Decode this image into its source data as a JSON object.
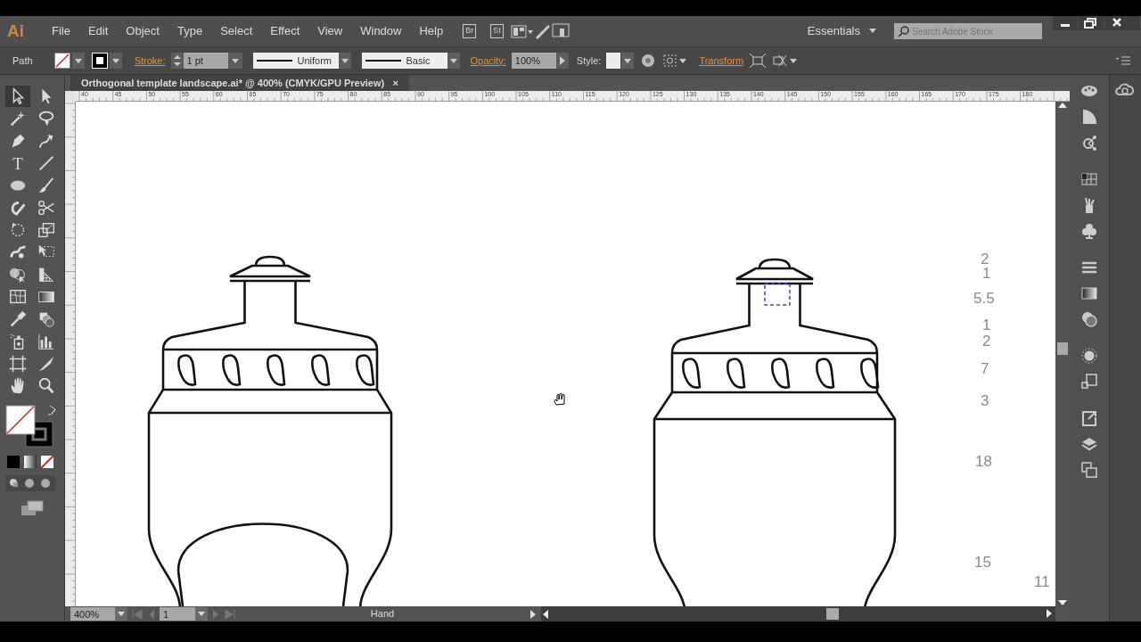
{
  "app": {
    "logo": "Ai"
  },
  "menu": [
    "File",
    "Edit",
    "Object",
    "Type",
    "Select",
    "Effect",
    "View",
    "Window",
    "Help"
  ],
  "app_bar": {
    "bridge": "Br",
    "stock": "St",
    "workspace": "Essentials",
    "search": {
      "placeholder": "Search Adobe Stock"
    }
  },
  "control_bar": {
    "selection": "Path",
    "stroke_label": "Stroke:",
    "stroke_weight": "1 pt",
    "profile": "Uniform",
    "brush": "Basic",
    "opacity_label": "Opacity:",
    "opacity": "100%",
    "style_label": "Style:",
    "transform": "Transform"
  },
  "document_tab": {
    "title": "Orthogonal template landscape.ai* @ 400% (CMYK/GPU Preview)",
    "close": "×"
  },
  "ruler": {
    "labels": [
      "40",
      "45",
      "50",
      "55",
      "60",
      "65",
      "70",
      "75",
      "80",
      "85",
      "90",
      "95",
      "100",
      "105",
      "110",
      "115",
      "120",
      "125",
      "130",
      "135",
      "140",
      "145",
      "150",
      "155",
      "160",
      "165",
      "170",
      "175",
      "180"
    ]
  },
  "tools": [
    {
      "kind": "selection",
      "selected": true
    },
    {
      "kind": "direct",
      "selected": false
    },
    {
      "kind": "wand",
      "selected": false
    },
    {
      "kind": "lasso",
      "selected": false
    },
    {
      "kind": "pen",
      "selected": false
    },
    {
      "kind": "curvature",
      "selected": false
    },
    {
      "kind": "type",
      "glyph": "T",
      "selected": false
    },
    {
      "kind": "line",
      "selected": false
    },
    {
      "kind": "ellipse",
      "selected": false
    },
    {
      "kind": "brush",
      "selected": false
    },
    {
      "kind": "shaper",
      "selected": false
    },
    {
      "kind": "scissors",
      "selected": false
    },
    {
      "kind": "rotate",
      "selected": false
    },
    {
      "kind": "scale",
      "selected": false
    },
    {
      "kind": "warp",
      "selected": false
    },
    {
      "kind": "free",
      "selected": false
    },
    {
      "kind": "builder",
      "selected": false
    },
    {
      "kind": "grid",
      "selected": false
    },
    {
      "kind": "mesh",
      "selected": false
    },
    {
      "kind": "gradient",
      "selected": false
    },
    {
      "kind": "eyedropper",
      "selected": false
    },
    {
      "kind": "blend",
      "selected": false
    },
    {
      "kind": "sprayer",
      "selected": false
    },
    {
      "kind": "graph",
      "selected": false
    },
    {
      "kind": "artboard",
      "selected": false
    },
    {
      "kind": "slice",
      "selected": false
    },
    {
      "kind": "hand",
      "selected": false
    },
    {
      "kind": "zoom",
      "selected": false
    }
  ],
  "annotations": [
    "2",
    "1",
    "5.5",
    "1",
    "2",
    "7",
    "3",
    "18",
    "15",
    "11"
  ],
  "status_bar": {
    "zoom": "400%",
    "artboard": "1",
    "tool": "Hand"
  }
}
